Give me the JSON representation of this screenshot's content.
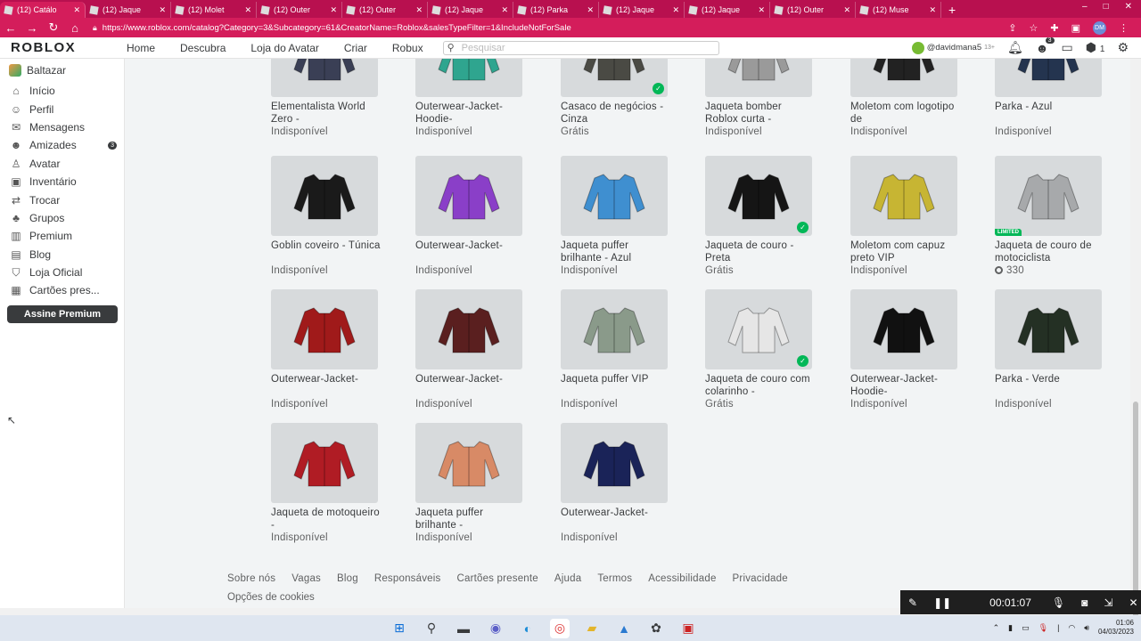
{
  "browser": {
    "tabs": [
      {
        "label": "(12) Catálo",
        "active": true
      },
      {
        "label": "(12) Jaque"
      },
      {
        "label": "(12) Molet"
      },
      {
        "label": "(12) Outer"
      },
      {
        "label": "(12) Outer"
      },
      {
        "label": "(12) Jaque"
      },
      {
        "label": "(12) Parka"
      },
      {
        "label": "(12) Jaque"
      },
      {
        "label": "(12) Jaque"
      },
      {
        "label": "(12) Outer"
      },
      {
        "label": "(12) Muse"
      }
    ],
    "new_tab": "+",
    "window_controls": [
      "–",
      "□",
      "✕"
    ],
    "url": "https://www.roblox.com/catalog?Category=3&Subcategory=61&CreatorName=Roblox&salesTypeFilter=1&IncludeNotForSale",
    "profile_initials": "DM"
  },
  "nav": {
    "logo": "ROBLOX",
    "links": [
      "Home",
      "Descubra",
      "Loja do Avatar",
      "Criar",
      "Robux"
    ],
    "search_placeholder": "Pesquisar",
    "username": "@davidmana5",
    "age": "13+",
    "friend_badge": "3",
    "robux": "1"
  },
  "sidebar": {
    "user": "Baltazar",
    "items": [
      {
        "label": "Início",
        "icon": "home-icon",
        "glyph": "⌂"
      },
      {
        "label": "Perfil",
        "icon": "profile-icon",
        "glyph": "☺"
      },
      {
        "label": "Mensagens",
        "icon": "messages-icon",
        "glyph": "✉"
      },
      {
        "label": "Amizades",
        "icon": "friends-icon",
        "glyph": "☻",
        "count": "3"
      },
      {
        "label": "Avatar",
        "icon": "avatar-icon",
        "glyph": "♙"
      },
      {
        "label": "Inventário",
        "icon": "inventory-icon",
        "glyph": "▣"
      },
      {
        "label": "Trocar",
        "icon": "trade-icon",
        "glyph": "⇄"
      },
      {
        "label": "Grupos",
        "icon": "groups-icon",
        "glyph": "♣"
      },
      {
        "label": "Premium",
        "icon": "premium-icon",
        "glyph": "▥"
      },
      {
        "label": "Blog",
        "icon": "blog-icon",
        "glyph": "▤"
      },
      {
        "label": "Loja Oficial",
        "icon": "store-icon",
        "glyph": "⛉"
      },
      {
        "label": "Cartões pres...",
        "icon": "gift-card-icon",
        "glyph": "▦"
      }
    ],
    "premium_button": "Assine Premium"
  },
  "items": [
    {
      "name": "Elementalista World Zero -",
      "price": "Indisponível",
      "color": "#3a3f55"
    },
    {
      "name": "Outerwear-Jacket-Hoodie-",
      "price": "Indisponível",
      "color": "#2fa58f"
    },
    {
      "name": "Casaco de negócios - Cinza",
      "price": "Grátis",
      "color": "#4a4a44",
      "owned": true
    },
    {
      "name": "Jaqueta bomber Roblox curta -",
      "price": "Indisponível",
      "color": "#9a9a9a"
    },
    {
      "name": "Moletom com logotipo de",
      "price": "Indisponível",
      "color": "#222"
    },
    {
      "name": "Parka - Azul",
      "price": "Indisponível",
      "color": "#24344f"
    },
    {
      "name": "Goblin coveiro - Túnica",
      "price": "Indisponível",
      "color": "#1a1a1a"
    },
    {
      "name": "Outerwear-Jacket-",
      "price": "Indisponível",
      "color": "#8a3fc8"
    },
    {
      "name": "Jaqueta puffer brilhante - Azul",
      "price": "Indisponível",
      "color": "#3f8fd0"
    },
    {
      "name": "Jaqueta de couro - Preta",
      "price": "Grátis",
      "color": "#151515",
      "owned": true
    },
    {
      "name": "Moletom com capuz preto VIP",
      "price": "Indisponível",
      "color": "#c7b533"
    },
    {
      "name": "Jaqueta de couro de motociclista",
      "price": "330",
      "color": "#a7a9ab",
      "limited": "LIMITED",
      "robux": true
    },
    {
      "name": "Outerwear-Jacket-",
      "price": "Indisponível",
      "color": "#a01a1a"
    },
    {
      "name": "Outerwear-Jacket-",
      "price": "Indisponível",
      "color": "#5a1f1f"
    },
    {
      "name": "Jaqueta puffer VIP",
      "price": "Indisponível",
      "color": "#8a9a8a"
    },
    {
      "name": "Jaqueta de couro com colarinho -",
      "price": "Grátis",
      "color": "#e6e6e6",
      "owned": true
    },
    {
      "name": "Outerwear-Jacket-Hoodie-",
      "price": "Indisponível",
      "color": "#111"
    },
    {
      "name": "Parka - Verde",
      "price": "Indisponível",
      "color": "#243024"
    },
    {
      "name": "Jaqueta de motoqueiro -",
      "price": "Indisponível",
      "color": "#b01c24"
    },
    {
      "name": "Jaqueta puffer brilhante -",
      "price": "Indisponível",
      "color": "#d88a66"
    },
    {
      "name": "Outerwear-Jacket-",
      "price": "Indisponível",
      "color": "#1a2358"
    }
  ],
  "footer": {
    "links": [
      "Sobre nós",
      "Vagas",
      "Blog",
      "Responsáveis",
      "Cartões presente",
      "Ajuda",
      "Termos",
      "Acessibilidade",
      "Privacidade"
    ],
    "cookie": "Opções de cookies"
  },
  "recorder": {
    "time": "00:01:07"
  },
  "taskbar": {
    "time": "01:06",
    "date": "04/03/2023"
  }
}
